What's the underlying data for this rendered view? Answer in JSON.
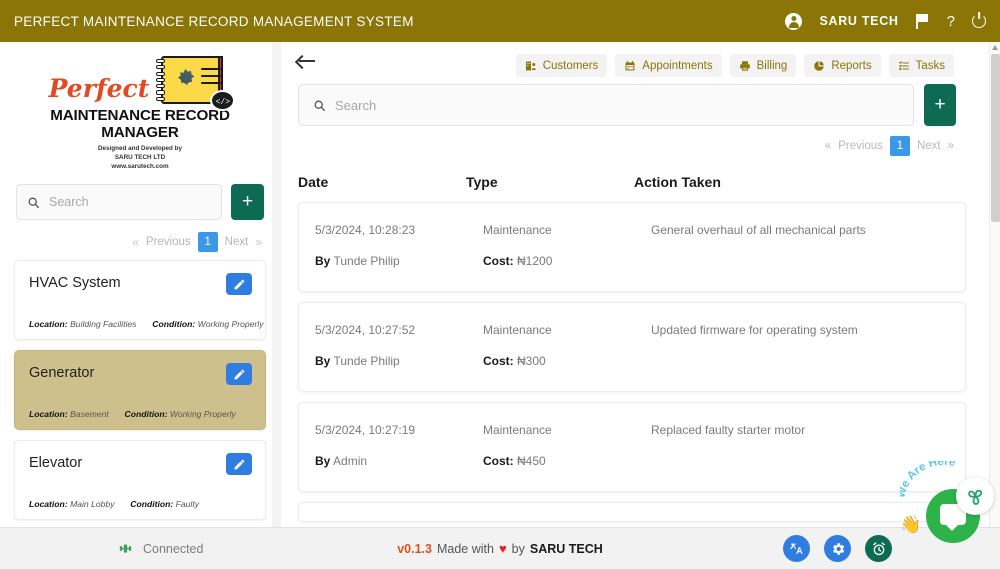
{
  "header": {
    "app_title": "PERFECT MAINTENANCE RECORD MANAGEMENT SYSTEM",
    "org_name": "SARU TECH",
    "account_icon": "account-circle-icon",
    "flag_icon": "flag-icon",
    "help_icon": "?",
    "power_icon": "power-icon",
    "bg_color": "#8a7506"
  },
  "sidebar": {
    "logo": {
      "word_perfect": "Perfect",
      "title": "MAINTENANCE RECORD MANAGER",
      "sub_line1": "Designed and Developed by",
      "sub_line2": "SARU TECH LTD",
      "sub_line3": "www.sarutech.com",
      "code_glyph": "</>"
    },
    "search": {
      "placeholder": "Search",
      "value": ""
    },
    "add_label": "+",
    "pagination": {
      "first": "«",
      "previous": "Previous",
      "current_page": "1",
      "next": "Next",
      "last": "»"
    },
    "meta_labels": {
      "location": "Location:",
      "condition": "Condition:"
    },
    "equipment": [
      {
        "name": "HVAC System",
        "location": "Building Facilities",
        "condition": "Working Properly",
        "active": false
      },
      {
        "name": "Generator",
        "location": "Basement",
        "condition": "Working Properly",
        "active": true
      },
      {
        "name": "Elevator",
        "location": "Main Lobby",
        "condition": "Faulty",
        "active": false
      }
    ]
  },
  "main": {
    "back_icon": "back-arrow-icon",
    "tabs": [
      {
        "label": "Customers",
        "icon": "customers-icon"
      },
      {
        "label": "Appointments",
        "icon": "calendar-icon"
      },
      {
        "label": "Billing",
        "icon": "printer-icon"
      },
      {
        "label": "Reports",
        "icon": "pie-chart-icon"
      },
      {
        "label": "Tasks",
        "icon": "task-list-icon"
      }
    ],
    "search": {
      "placeholder": "Search",
      "value": ""
    },
    "add_label": "+",
    "pagination": {
      "first": "«",
      "previous": "Previous",
      "current_page": "1",
      "next": "Next",
      "last": "»"
    },
    "table": {
      "columns": {
        "date": "Date",
        "type": "Type",
        "action": "Action Taken"
      },
      "by_label": "By",
      "cost_label": "Cost:",
      "rows": [
        {
          "date": "5/3/2024, 10:28:23",
          "type": "Maintenance",
          "action": "General overhaul of all mechanical parts",
          "by": "Tunde Philip",
          "cost": "₦1200"
        },
        {
          "date": "5/3/2024, 10:27:52",
          "type": "Maintenance",
          "action": "Updated firmware for operating system",
          "by": "Tunde Philip",
          "cost": "₦300"
        },
        {
          "date": "5/3/2024, 10:27:19",
          "type": "Maintenance",
          "action": "Replaced faulty starter motor",
          "by": "Admin",
          "cost": "₦450"
        }
      ]
    }
  },
  "footer": {
    "connection_status": "Connected",
    "connection_icon": "plug-connected-icon",
    "version": "v0.1.3",
    "made_with": "Made with",
    "heart": "♥",
    "by": "by",
    "brand": "SARU TECH",
    "icons": [
      {
        "name": "translate-icon",
        "glyph": "文A"
      },
      {
        "name": "gear-icon",
        "glyph": "gear"
      },
      {
        "name": "alarm-clock-icon",
        "glyph": "alarm"
      }
    ]
  },
  "chat_widget": {
    "arc_text": "We Are Here",
    "hand_icon": "👋",
    "badge_icon": "pinwheel-icon",
    "bubble_icon": "chat-bubble-icon"
  }
}
